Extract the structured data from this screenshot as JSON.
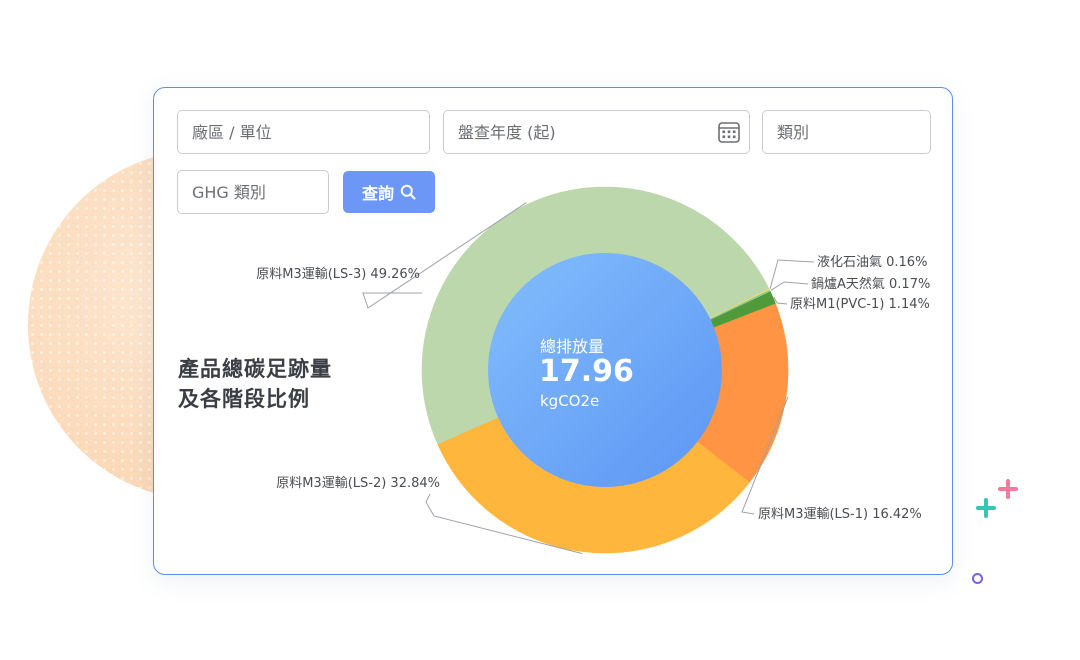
{
  "filters": {
    "plant_unit_placeholder": "廠區 / 單位",
    "inventory_year_placeholder": "盤查年度 (起)",
    "category_placeholder": "類別",
    "ghg_category_placeholder": "GHG 類別",
    "query_label": "查詢"
  },
  "panel": {
    "title_line1": "產品總碳足跡量",
    "title_line2": "及各階段比例"
  },
  "center": {
    "label": "總排放量",
    "value": "17.96",
    "unit": "kgCO2e"
  },
  "colors": {
    "accent": "#5b8def",
    "button": "#6d97f7"
  },
  "chart_data": {
    "type": "pie",
    "donut": true,
    "total": 17.96,
    "total_unit": "kgCO2e",
    "slices": [
      {
        "name": "液化石油氣",
        "percent": 0.16,
        "label": "液化石油氣 0.16%",
        "color": "#f2e25a"
      },
      {
        "name": "鍋爐A天然氣",
        "percent": 0.17,
        "label": "鍋爐A天然氣 0.17%",
        "color": "#8fc9a0"
      },
      {
        "name": "原料M1(PVC-1)",
        "percent": 1.14,
        "label": "原料M1(PVC-1) 1.14%",
        "color": "#4f9a3a"
      },
      {
        "name": "原料M3運輸(LS-1)",
        "percent": 16.42,
        "label": "原料M3運輸(LS-1) 16.42%",
        "color": "#ff9444"
      },
      {
        "name": "原料M3運輸(LS-2)",
        "percent": 32.84,
        "label": "原料M3運輸(LS-2) 32.84%",
        "color": "#ffb63c"
      },
      {
        "name": "原料M3運輸(LS-3)",
        "percent": 49.26,
        "label": "原料M3運輸(LS-3) 49.26%",
        "color": "#bcd7ab"
      }
    ]
  }
}
